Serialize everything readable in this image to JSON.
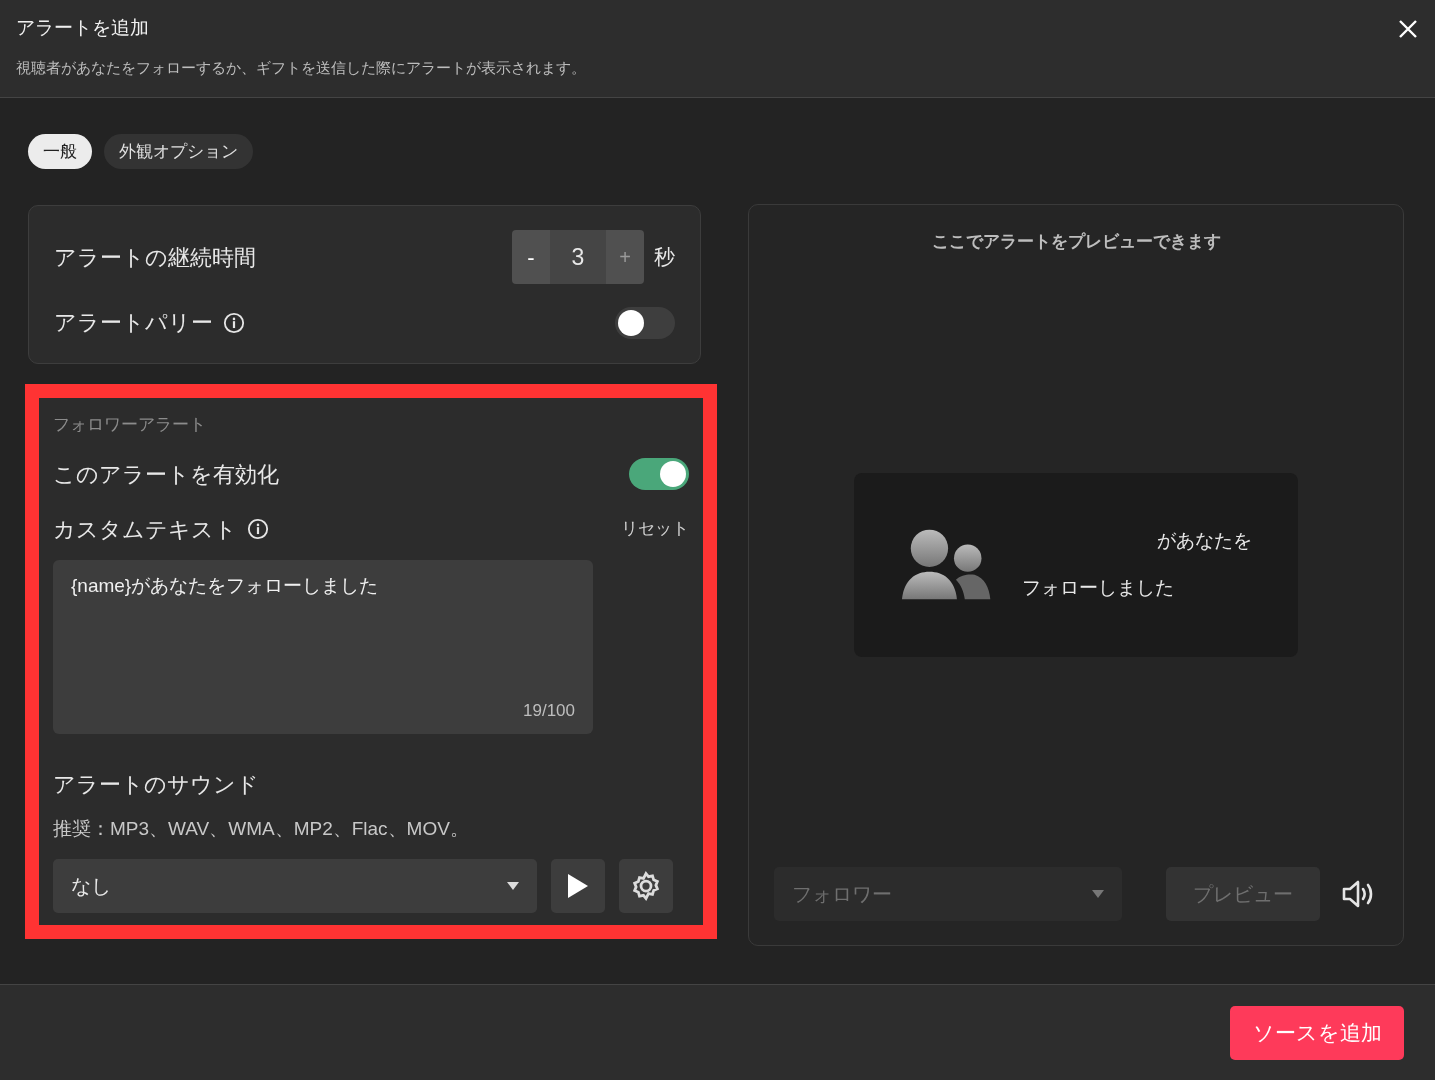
{
  "dialog": {
    "title": "アラートを追加",
    "description": "視聴者があなたをフォローするか、ギフトを送信した際にアラートが表示されます。"
  },
  "tabs": [
    {
      "label": "一般",
      "selected": true
    },
    {
      "label": "外観オプション",
      "selected": false
    }
  ],
  "duration": {
    "label": "アラートの継続時間",
    "decrement": "-",
    "value": "3",
    "increment": "+",
    "unit": "秒"
  },
  "party": {
    "label": "アラートパリー",
    "on": false
  },
  "follower_alert": {
    "highlighted": true,
    "heading": "フォロワーアラート",
    "enable": {
      "label": "このアラートを有効化",
      "on": true
    },
    "custom_text": {
      "label": "カスタムテキスト",
      "reset": "リセット",
      "value": "{name}があなたをフォローしました",
      "counter": "19/100"
    },
    "sound": {
      "label": "アラートのサウンド",
      "hint": "推奨：MP3、WAV、WMA、MP2、Flac、MOV。",
      "value": "なし"
    }
  },
  "preview": {
    "title": "ここでアラートをプレビューできます",
    "line_1": "があなたを",
    "line_2": "フォローしました",
    "event": "フォロワー",
    "button": "プレビュー"
  },
  "footer": {
    "button": "ソースを追加"
  }
}
